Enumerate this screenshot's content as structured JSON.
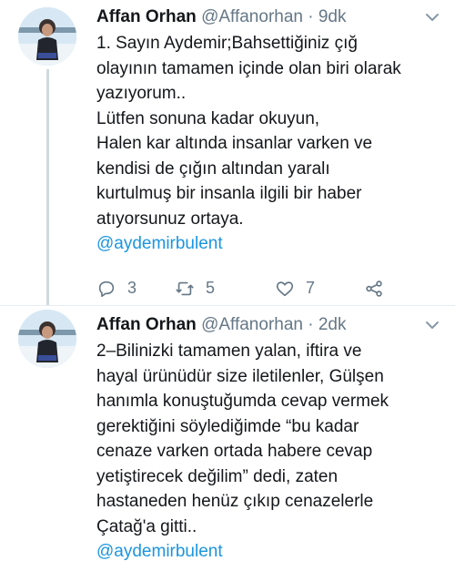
{
  "tweets": [
    {
      "author": {
        "name": "Affan Orhan",
        "handle": "@Affanorhan"
      },
      "separator": "·",
      "time": "9dk",
      "text": "1. Sayın Aydemir;Bahsettiğiniz çığ\nolayının tamamen içinde olan biri olarak\nyazıyorum..\nLütfen sonuna kadar okuyun,\nHalen kar altında insanlar varken ve\nkendisi de çığın altından yaralı\nkurtulmuş bir insanla ilgili bir haber\natıyorsunuz ortaya.",
      "mention": "@aydemirbulent",
      "actions": {
        "replies": "3",
        "retweets": "5",
        "likes": "7"
      },
      "icons": [
        "reply-icon",
        "retweet-icon",
        "like-icon",
        "share-icon",
        "chevron-down-icon"
      ]
    },
    {
      "author": {
        "name": "Affan Orhan",
        "handle": "@Affanorhan"
      },
      "separator": "·",
      "time": "2dk",
      "text": "2–Bilinizki tamamen yalan, iftira ve\nhayal ürünüdür size iletilenler, Gülşen\nhanımla konuştuğumda cevap vermek\ngerektiğini söylediğimde “bu kadar\ncenaze varken ortada habere cevap\nyetiştirecek değilim” dedi, zaten\nhastaneden henüz çıkıp cenazelerle\nÇatağ'a gitti..",
      "mention": "@aydemirbulent",
      "icons": [
        "chevron-down-icon"
      ]
    }
  ],
  "colors": {
    "text": "#14171a",
    "secondary": "#657786",
    "link": "#1b95e0",
    "divider": "#e6ecf0",
    "thread_line": "#cfd9de"
  }
}
